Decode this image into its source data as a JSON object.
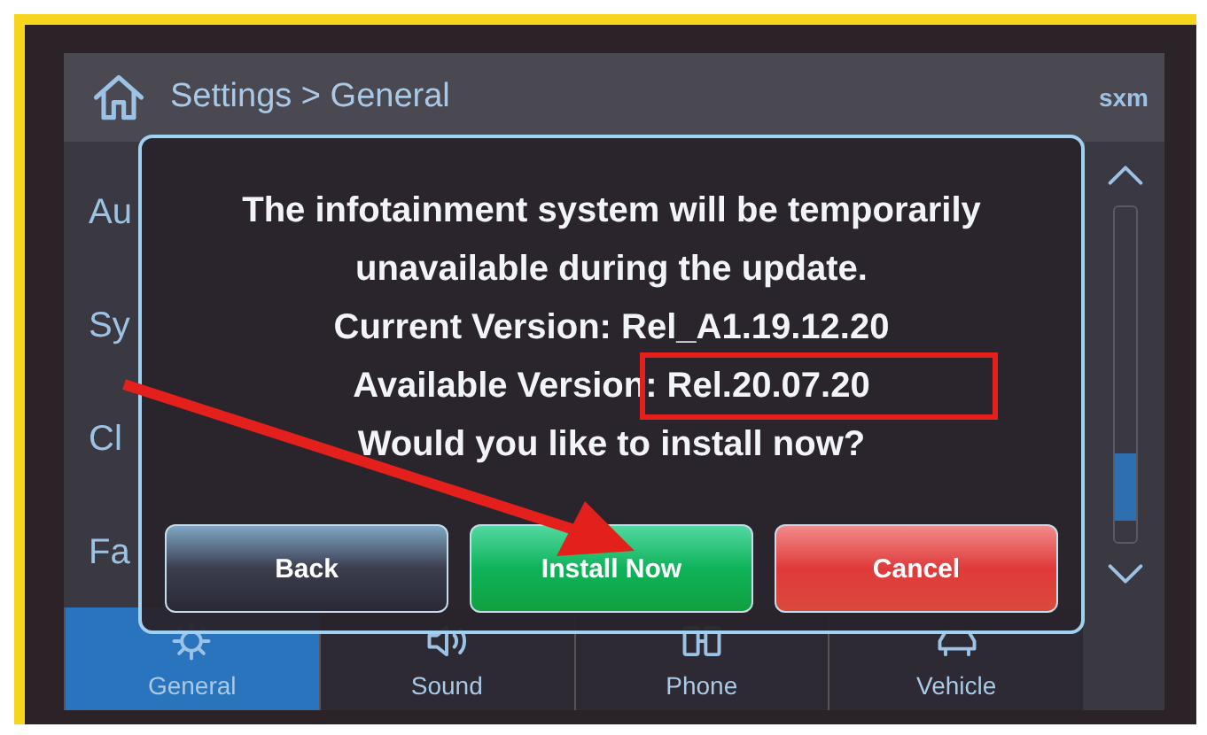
{
  "header": {
    "breadcrumb": "Settings > General",
    "source_badge": "sxm"
  },
  "list_items": [
    {
      "label": "Au"
    },
    {
      "label": "Sy"
    },
    {
      "label": "Cl"
    },
    {
      "label": "Fa"
    }
  ],
  "dialog": {
    "lines": [
      "The infotainment system will be temporarily",
      "unavailable during the update.",
      "Current Version: Rel_A1.19.12.20",
      "Available Version: Rel.20.07.20",
      "Would you like to install now?"
    ],
    "buttons": [
      {
        "label": "Back",
        "kind": "neutral"
      },
      {
        "label": "Install Now",
        "kind": "confirm"
      },
      {
        "label": "Cancel",
        "kind": "danger"
      }
    ]
  },
  "tabs": [
    {
      "label": "General",
      "selected": true
    },
    {
      "label": "Sound",
      "selected": false
    },
    {
      "label": "Phone",
      "selected": false
    },
    {
      "label": "Vehicle",
      "selected": false
    }
  ]
}
